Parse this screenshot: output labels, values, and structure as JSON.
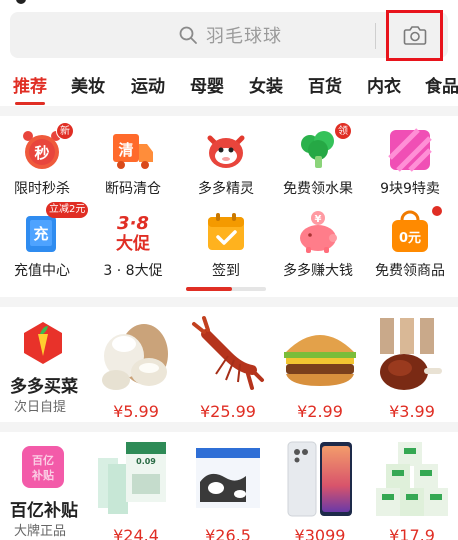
{
  "search": {
    "placeholder": "羽毛球球",
    "camera_icon": "camera-icon"
  },
  "tabs": [
    {
      "label": "推荐",
      "active": true
    },
    {
      "label": "美妆"
    },
    {
      "label": "运动"
    },
    {
      "label": "母婴"
    },
    {
      "label": "女装"
    },
    {
      "label": "百货"
    },
    {
      "label": "内衣"
    },
    {
      "label": "食品"
    }
  ],
  "grid": {
    "row1": [
      {
        "label": "限时秒杀",
        "icon": "alarm-clock-icon",
        "icon_text": "秒",
        "badge": "新"
      },
      {
        "label": "断码清仓",
        "icon": "delivery-truck-icon",
        "icon_text": "清"
      },
      {
        "label": "多多精灵",
        "icon": "cow-mascot-icon"
      },
      {
        "label": "免费领水果",
        "icon": "broccoli-icon",
        "badge": "领"
      },
      {
        "label": "9块9特卖",
        "icon": "gift-box-icon"
      }
    ],
    "row2": [
      {
        "label": "充值中心",
        "icon": "phone-recharge-icon",
        "icon_text": "充",
        "badge": "立减2元"
      },
      {
        "label": "3 · 8大促",
        "icon": "sale-38-icon",
        "icon_text_top": "3·8",
        "icon_text_bottom": "大促"
      },
      {
        "label": "签到",
        "icon": "calendar-check-icon"
      },
      {
        "label": "多多赚大钱",
        "icon": "piggy-bank-icon",
        "icon_text": "¥"
      },
      {
        "label": "免费领商品",
        "icon": "zero-yuan-bag-icon",
        "icon_text": "0元"
      }
    ]
  },
  "sections": [
    {
      "title": "多多买菜",
      "subtitle": "次日自提",
      "logo": "carrot-logo-icon",
      "products": [
        {
          "image": "coconut-image",
          "price": "¥5.99"
        },
        {
          "image": "crayfish-image",
          "price": "¥25.99"
        },
        {
          "image": "burger-image",
          "price": "¥2.99"
        },
        {
          "image": "braised-duck-image",
          "price": "¥3.99"
        }
      ]
    },
    {
      "title": "百亿补贴",
      "subtitle": "大牌正品",
      "logo": "subsidy-logo-icon",
      "logo_text": "百亿补贴",
      "products": [
        {
          "image": "milk-cartons-image",
          "price": "¥24.4",
          "label_text": "0.09 鲜活 牛奶"
        },
        {
          "image": "milk-box-image",
          "price": "¥26.5"
        },
        {
          "image": "smartphone-image",
          "price": "¥3099"
        },
        {
          "image": "yogurt-boxes-image",
          "price": "¥17.9",
          "label_text": "益浓"
        }
      ]
    }
  ],
  "colors": {
    "accent": "#e02e24",
    "highlight_box": "#e8141c",
    "band": "#f4f4f4"
  }
}
